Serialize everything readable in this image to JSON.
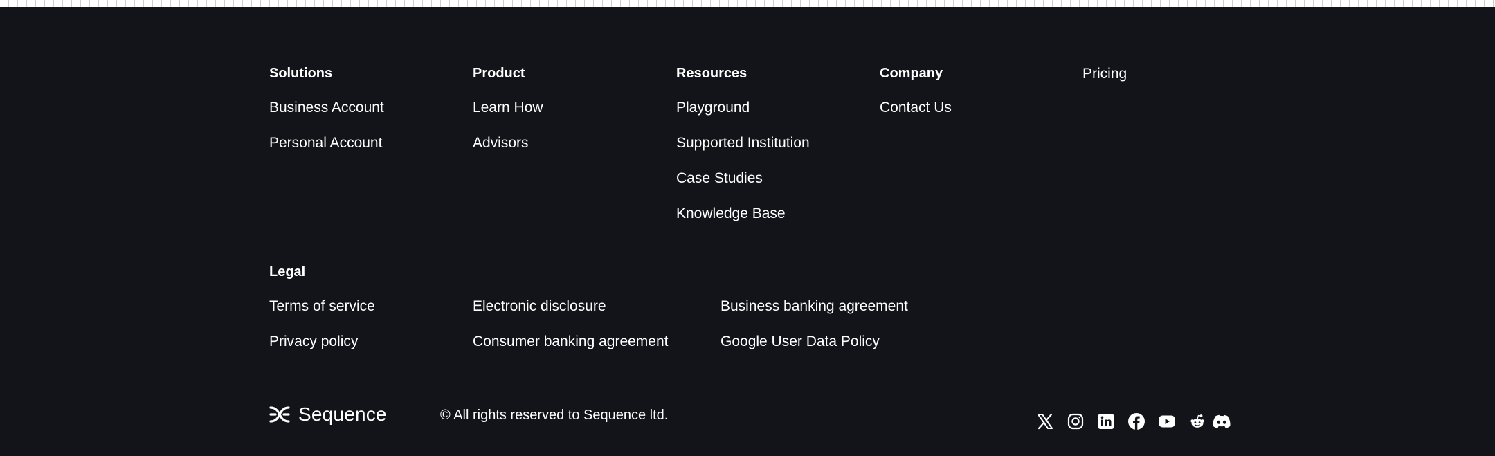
{
  "footer": {
    "columns": [
      {
        "title": "Solutions",
        "links": [
          "Business Account",
          "Personal Account"
        ]
      },
      {
        "title": "Product",
        "links": [
          "Learn How",
          "Advisors"
        ]
      },
      {
        "title": "Resources",
        "links": [
          "Playground",
          "Supported Institution",
          "Case Studies",
          "Knowledge Base"
        ]
      },
      {
        "title": "Company",
        "links": [
          "Contact Us"
        ]
      }
    ],
    "pricing": "Pricing",
    "legal": {
      "title": "Legal",
      "links": [
        "Terms of service",
        "Privacy policy",
        "Electronic disclosure",
        "Consumer banking agreement",
        "Business banking agreement",
        "Google User Data Policy"
      ]
    },
    "brand": {
      "name": "Sequence",
      "icon": "sequence-logo-icon"
    },
    "copyright": "© All rights reserved to Sequence ltd.",
    "social_icons": [
      "x-icon",
      "instagram-icon",
      "linkedin-icon",
      "facebook-icon",
      "youtube-icon",
      "reddit-icon",
      "discord-icon"
    ],
    "colors": {
      "background": "#131419",
      "text": "#ffffff",
      "divider": "#d9d9dc"
    }
  }
}
